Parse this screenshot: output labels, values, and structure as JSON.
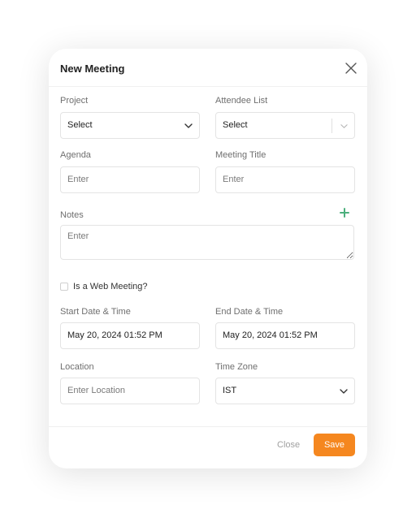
{
  "modal": {
    "title": "New Meeting",
    "close_icon": "close-icon"
  },
  "form": {
    "project": {
      "label": "Project",
      "value": "Select"
    },
    "attendee_list": {
      "label": "Attendee List",
      "value": "Select"
    },
    "agenda": {
      "label": "Agenda",
      "placeholder": "Enter"
    },
    "meeting_title": {
      "label": "Meeting Title",
      "placeholder": "Enter"
    },
    "notes": {
      "label": "Notes",
      "placeholder": "Enter",
      "add_icon": "plus-icon",
      "add_icon_color": "#4caf7d"
    },
    "web_meeting": {
      "label": "Is a Web Meeting?",
      "checked": false
    },
    "start_datetime": {
      "label": "Start Date & Time",
      "value": "May 20, 2024 01:52 PM"
    },
    "end_datetime": {
      "label": "End Date & Time",
      "value": "May 20, 2024 01:52 PM"
    },
    "location": {
      "label": "Location",
      "placeholder": "Enter Location"
    },
    "time_zone": {
      "label": "Time Zone",
      "value": "IST"
    }
  },
  "footer": {
    "close_label": "Close",
    "save_label": "Save",
    "save_color": "#f5871f"
  }
}
